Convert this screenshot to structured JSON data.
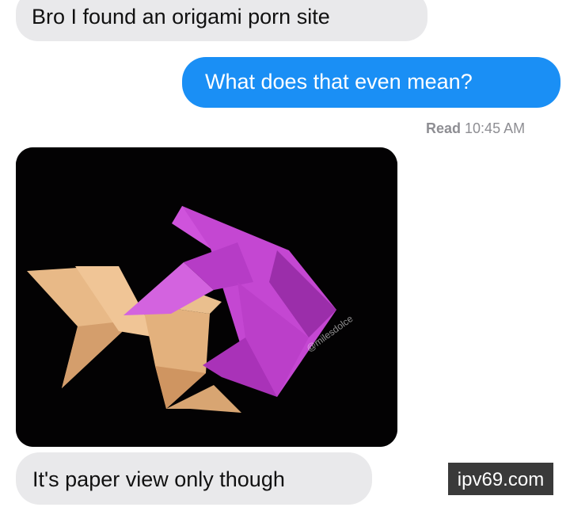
{
  "conversation": {
    "messages": [
      {
        "direction": "incoming",
        "text": "Bro I found an origami porn site"
      },
      {
        "direction": "outgoing",
        "text": "What does that even mean?"
      }
    ],
    "read_receipt": {
      "label": "Read",
      "time": "10:45 AM"
    },
    "photo": {
      "subject": "two folded paper origami figures, one tan and one magenta, on a black background",
      "credit": "@milesdolce"
    },
    "reply": {
      "direction": "incoming",
      "text": "It's paper view only though"
    }
  },
  "watermark": {
    "text": "ipv69.com"
  },
  "colors": {
    "incoming_bubble": "#e9e9eb",
    "outgoing_bubble": "#1a8ff5",
    "receipt_text": "#8e8e93",
    "tan_paper": "#e6b886",
    "magenta_paper": "#c64ad4",
    "photo_background": "#030203"
  }
}
